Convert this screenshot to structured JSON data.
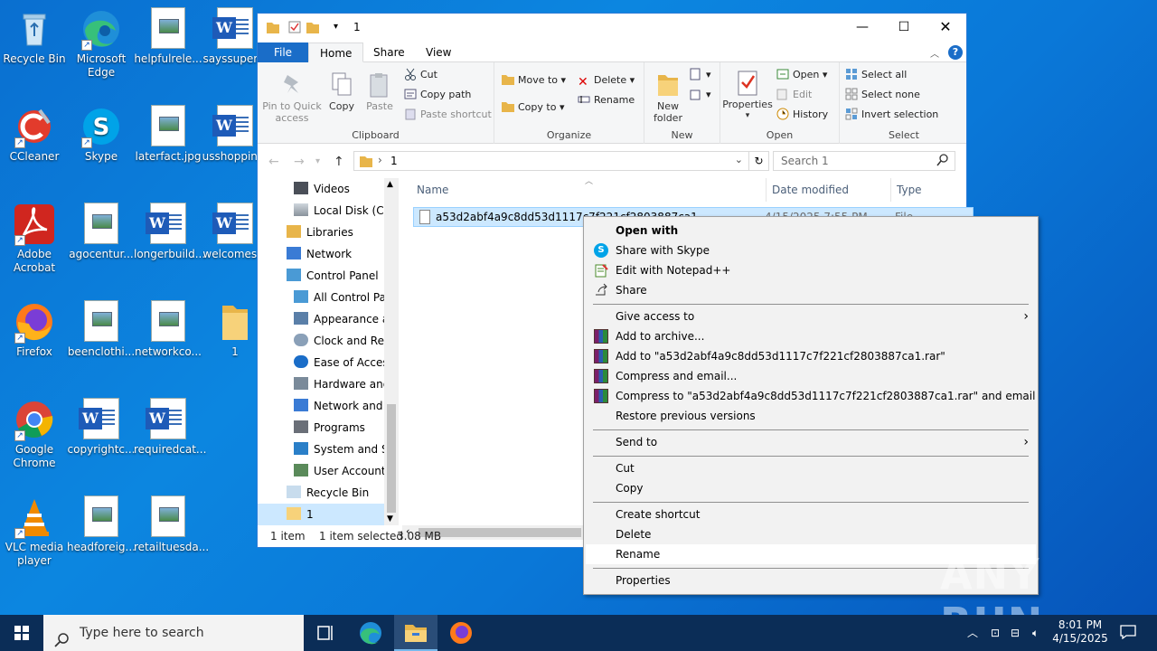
{
  "desktop": {
    "icons": [
      {
        "label": "Recycle Bin"
      },
      {
        "label": "Microsoft Edge"
      },
      {
        "label": "helpfulrele..."
      },
      {
        "label": "sayssuper..."
      },
      {
        "label": "CCleaner"
      },
      {
        "label": "Skype"
      },
      {
        "label": "laterfact.jpg"
      },
      {
        "label": "usshoppin..."
      },
      {
        "label": "Adobe Acrobat"
      },
      {
        "label": "agocentur..."
      },
      {
        "label": "longerbuild..."
      },
      {
        "label": "welcomes..."
      },
      {
        "label": "Firefox"
      },
      {
        "label": "beenclothi..."
      },
      {
        "label": "networkco..."
      },
      {
        "label": "1"
      },
      {
        "label": "Google Chrome"
      },
      {
        "label": "copyrightc..."
      },
      {
        "label": "requiredcat..."
      },
      {
        "label": "VLC media player"
      },
      {
        "label": "headforeig..."
      },
      {
        "label": "retailtuesda..."
      }
    ]
  },
  "explorer": {
    "title": "1",
    "tabs": {
      "file": "File",
      "home": "Home",
      "share": "Share",
      "view": "View"
    },
    "ribbon": {
      "clipboard": {
        "pin": "Pin to Quick access",
        "copy": "Copy",
        "paste": "Paste",
        "cut": "Cut",
        "copy_path": "Copy path",
        "paste_shortcut": "Paste shortcut",
        "label": "Clipboard"
      },
      "organize": {
        "move_to": "Move to",
        "copy_to": "Copy to",
        "delete": "Delete",
        "rename": "Rename",
        "label": "Organize"
      },
      "new": {
        "new_folder": "New folder",
        "label": "New"
      },
      "open": {
        "properties": "Properties",
        "open": "Open",
        "edit": "Edit",
        "history": "History",
        "label": "Open"
      },
      "select": {
        "select_all": "Select all",
        "select_none": "Select none",
        "invert": "Invert selection",
        "label": "Select"
      }
    },
    "address": {
      "path": "1",
      "search_placeholder": "Search 1"
    },
    "nav_items": [
      {
        "label": "Videos"
      },
      {
        "label": "Local Disk (C:)"
      },
      {
        "label": "Libraries"
      },
      {
        "label": "Network"
      },
      {
        "label": "Control Panel"
      },
      {
        "label": "All Control Panel Items"
      },
      {
        "label": "Appearance and Personalization"
      },
      {
        "label": "Clock and Region"
      },
      {
        "label": "Ease of Access"
      },
      {
        "label": "Hardware and Sound"
      },
      {
        "label": "Network and Internet"
      },
      {
        "label": "Programs"
      },
      {
        "label": "System and Security"
      },
      {
        "label": "User Accounts"
      },
      {
        "label": "Recycle Bin"
      },
      {
        "label": "1"
      }
    ],
    "columns": {
      "name": "Name",
      "date": "Date modified",
      "type": "Type"
    },
    "file": {
      "name": "a53d2abf4a9c8dd53d1117c7f221cf2803887ca1",
      "date": "4/15/2025 7:55 PM",
      "type": "File"
    },
    "status": {
      "count": "1 item",
      "selected": "1 item selected",
      "size": "3.08 MB"
    }
  },
  "context_menu": {
    "open_with": "Open with",
    "share_skype": "Share with Skype",
    "edit_notepad": "Edit with Notepad++",
    "share": "Share",
    "give_access": "Give access to",
    "add_archive": "Add to archive...",
    "add_rar": "Add to \"a53d2abf4a9c8dd53d1117c7f221cf2803887ca1.rar\"",
    "compress_email": "Compress and email...",
    "compress_rar_email": "Compress to \"a53d2abf4a9c8dd53d1117c7f221cf2803887ca1.rar\" and email",
    "restore": "Restore previous versions",
    "send_to": "Send to",
    "cut": "Cut",
    "copy": "Copy",
    "create_shortcut": "Create shortcut",
    "delete": "Delete",
    "rename": "Rename",
    "properties": "Properties"
  },
  "taskbar": {
    "search_placeholder": "Type here to search",
    "time": "8:01 PM",
    "date": "4/15/2025"
  },
  "watermark": "ANY RUN"
}
